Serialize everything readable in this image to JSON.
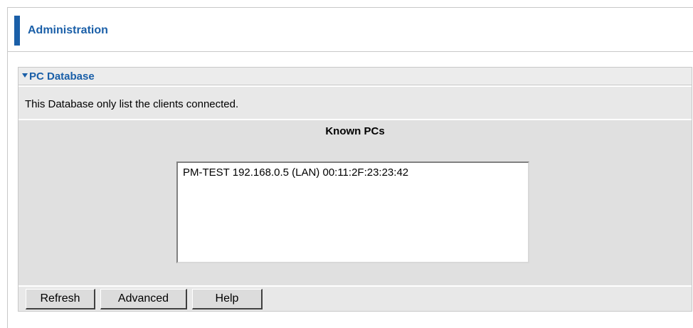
{
  "header": {
    "title": "Administration"
  },
  "panel": {
    "title": "PC Database",
    "description": "This Database only list the clients connected."
  },
  "known_pcs": {
    "heading": "Known PCs",
    "items": [
      "PM-TEST 192.168.0.5 (LAN) 00:11:2F:23:23:42"
    ]
  },
  "buttons": {
    "refresh": "Refresh",
    "advanced": "Advanced",
    "help": "Help"
  },
  "colors": {
    "accent": "#1a5fa8",
    "panel_bg": "#e8e8e8",
    "list_area_bg": "#e0e0e0",
    "button_bg": "#dcdcdc"
  }
}
